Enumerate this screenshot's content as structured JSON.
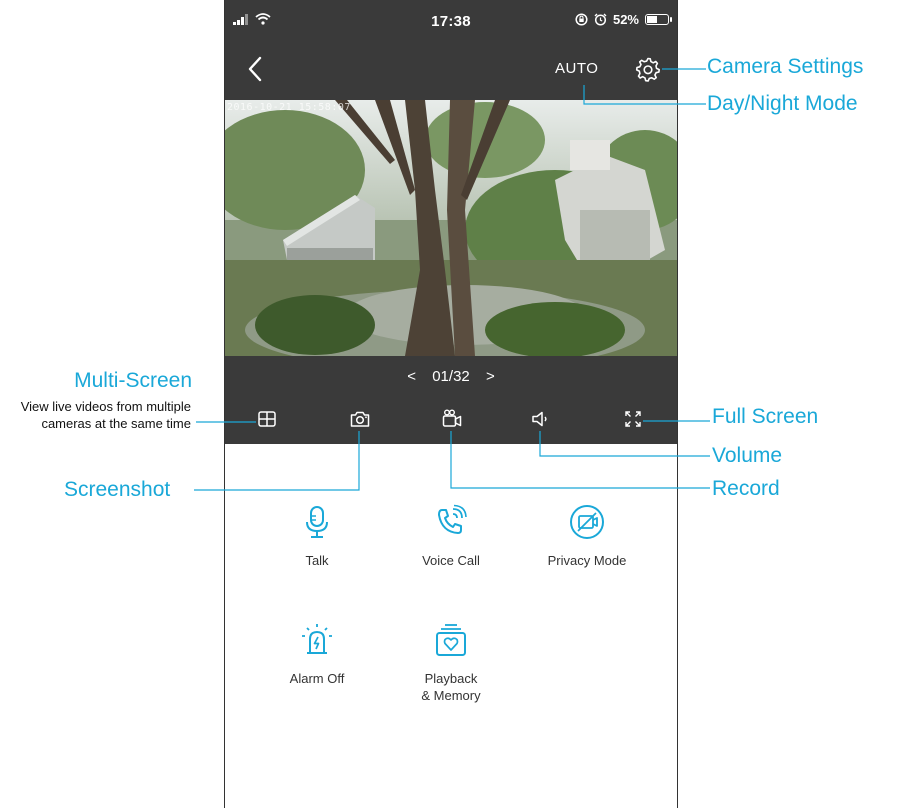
{
  "status_bar": {
    "time": "17:38",
    "battery": "52%",
    "battery_level": 0.52
  },
  "header": {
    "mode_label": "AUTO"
  },
  "video": {
    "timestamp": "2016-10-21 15:58:07"
  },
  "pager": {
    "prev": "<",
    "label": "01/32",
    "next": ">"
  },
  "actions": [
    {
      "label": "Talk",
      "icon": "microphone-icon"
    },
    {
      "label": "Voice Call",
      "icon": "phone-call-icon"
    },
    {
      "label": "Privacy Mode",
      "icon": "privacy-camera-off-icon"
    },
    {
      "label": "Alarm Off",
      "icon": "alarm-siren-icon"
    },
    {
      "label": "Playback\n& Memory",
      "icon": "playback-memory-icon"
    }
  ],
  "annotations": {
    "camera_settings": "Camera Settings",
    "day_night_mode": "Day/Night Mode",
    "multi_screen": "Multi-Screen",
    "multi_screen_desc": "View live videos from multiple cameras at the same time",
    "full_screen": "Full Screen",
    "volume": "Volume",
    "screenshot": "Screenshot",
    "record": "Record"
  },
  "colors": {
    "accent": "#1aa8d8",
    "dark_bar": "#3a3a3a",
    "text": "#333333"
  }
}
